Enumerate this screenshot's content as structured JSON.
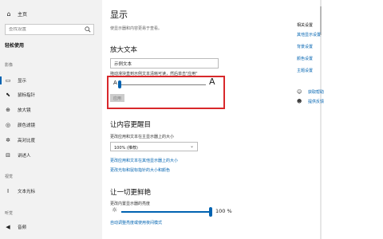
{
  "sidebar": {
    "home": "主页",
    "search_placeholder": "查找设置",
    "title": "轻松使用",
    "section_vision": "影像",
    "section_hearing": "听觉",
    "section_recent": "视觉",
    "items": [
      {
        "label": "显示",
        "icon": "display-icon"
      },
      {
        "label": "鼠标指针",
        "icon": "mouse-pointer-icon"
      },
      {
        "label": "放大镜",
        "icon": "magnifier-icon"
      },
      {
        "label": "颜色滤镜",
        "icon": "color-filter-icon"
      },
      {
        "label": "高对比度",
        "icon": "high-contrast-icon"
      },
      {
        "label": "讲述人",
        "icon": "narrator-icon"
      },
      {
        "label": "文本光标",
        "icon": "text-cursor-icon"
      },
      {
        "label": "音频",
        "icon": "audio-icon"
      }
    ]
  },
  "main": {
    "title": "显示",
    "description": "使显示器和内容更易于查看。",
    "enlarge_text": {
      "heading": "放大文本",
      "sample_text": "示例文本",
      "instruction": "拖动滑块直到示例文本清晰可读，然后单击\"应用\"",
      "small_a": "A",
      "big_a": "A",
      "apply": "应用",
      "slider_value": 0
    },
    "make_bigger": {
      "heading": "让内容更醒目",
      "size_label": "更改应用和文本在主显示器上的大小",
      "selected": "100% (推荐)",
      "link1": "更改应用和文本在其他显示器上的大小",
      "link2": "更改光标和鼠标指针的大小和颜色"
    },
    "brighter": {
      "heading": "让一切更鲜艳",
      "brightness_label": "更改内置显示器的亮度",
      "brightness_value": "100 %",
      "brightness_level": 100,
      "link": "自动调整亮度或使用夜间模式"
    }
  },
  "related": {
    "title": "相关设置",
    "links": [
      "其他显示设置",
      "背景设置",
      "颜色设置",
      "主题设置"
    ],
    "help": [
      {
        "label": "获取帮助",
        "icon": "help-icon"
      },
      {
        "label": "提供反馈",
        "icon": "feedback-icon"
      }
    ]
  }
}
